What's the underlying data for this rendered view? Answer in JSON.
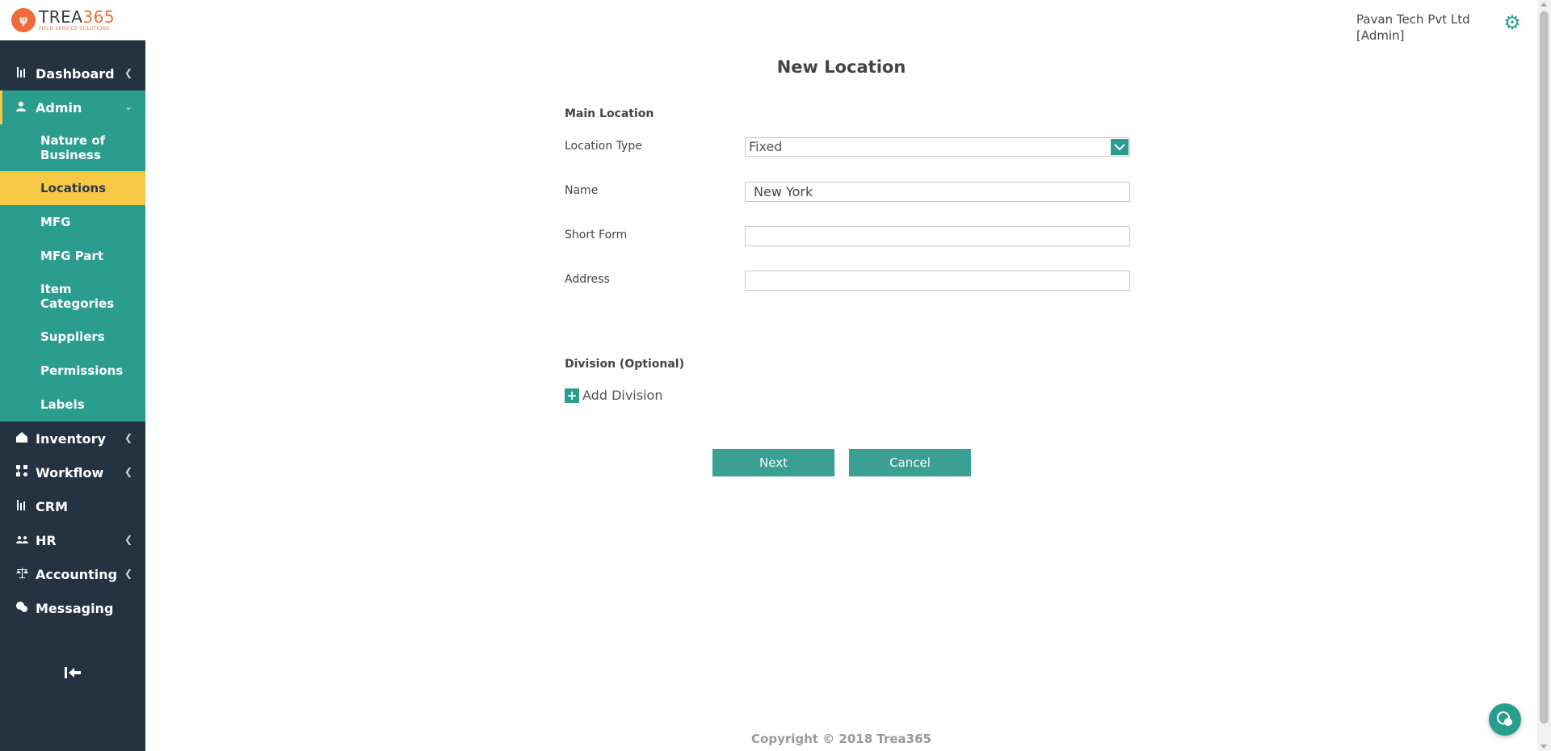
{
  "brand": {
    "logo_mark": "ψ",
    "name_prefix": "TREA",
    "name_number": "365",
    "tagline": "FIELD SERVICE SOLUTIONS"
  },
  "header": {
    "company_name": "Pavan Tech Pvt Ltd",
    "role": "[Admin]"
  },
  "sidebar": {
    "items": [
      {
        "label": "Dashboard",
        "icon": "bar-chart-icon"
      },
      {
        "label": "Admin",
        "icon": "user-icon"
      },
      {
        "label": "Inventory",
        "icon": "home-icon"
      },
      {
        "label": "Workflow",
        "icon": "workflow-icon"
      },
      {
        "label": "CRM",
        "icon": "bar-chart-icon"
      },
      {
        "label": "HR",
        "icon": "users-icon"
      },
      {
        "label": "Accounting",
        "icon": "scale-icon"
      },
      {
        "label": "Messaging",
        "icon": "chat-icon"
      }
    ],
    "admin_submenu": [
      {
        "label": "Nature of Business"
      },
      {
        "label": "Locations"
      },
      {
        "label": "MFG"
      },
      {
        "label": "MFG Part"
      },
      {
        "label": "Item Categories"
      },
      {
        "label": "Suppliers"
      },
      {
        "label": "Permissions"
      },
      {
        "label": "Labels"
      }
    ],
    "collapse_icon": "collapse-left-icon"
  },
  "main": {
    "title": "New Location",
    "main_section": "Main Location",
    "fields": {
      "location_type": {
        "label": "Location Type",
        "value": "Fixed"
      },
      "name": {
        "label": "Name",
        "value": "New York"
      },
      "short_form": {
        "label": "Short Form",
        "value": ""
      },
      "address": {
        "label": "Address",
        "value": ""
      }
    },
    "division_section": "Division (Optional)",
    "add_division_label": "Add Division",
    "next_label": "Next",
    "cancel_label": "Cancel"
  },
  "footer": {
    "copyright": "Copyright © 2018 Trea365"
  },
  "colors": {
    "sidebar_bg": "#243241",
    "accent_teal": "#2a9d8f",
    "highlight_yellow": "#f7c844",
    "brand_orange": "#ef6b3a"
  }
}
